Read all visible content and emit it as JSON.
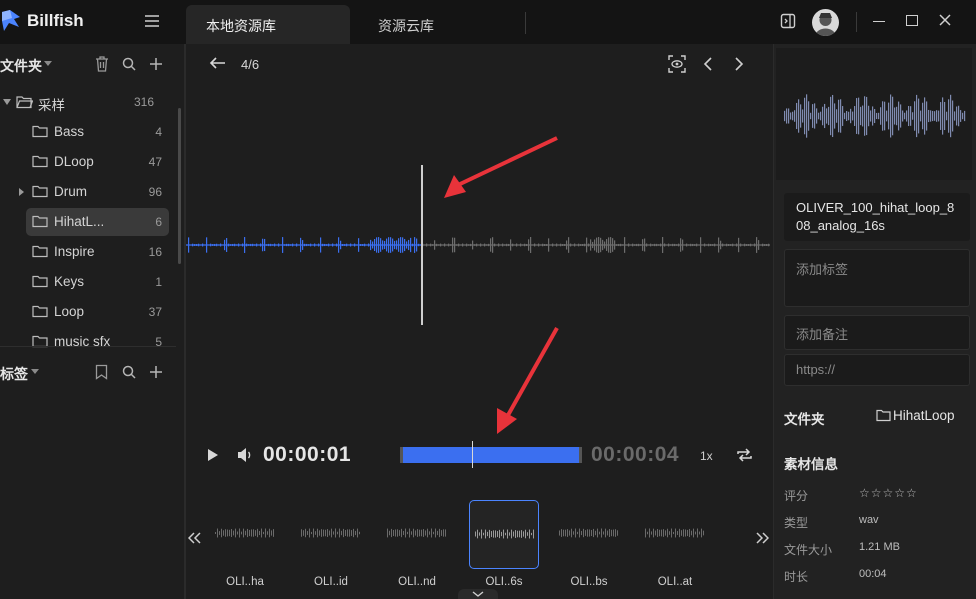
{
  "app": {
    "name": "Billfish"
  },
  "tabs": [
    {
      "label": "本地资源库",
      "active": true
    },
    {
      "label": "资源云库",
      "active": false
    }
  ],
  "sidebar": {
    "folders_title": "文件夹",
    "tags_title": "标签",
    "root": {
      "label": "采样",
      "count": "316"
    },
    "items": [
      {
        "label": "Bass",
        "count": "4"
      },
      {
        "label": "DLoop",
        "count": "47"
      },
      {
        "label": "Drum",
        "count": "96"
      },
      {
        "label": "HihatL...",
        "count": "6",
        "active": true
      },
      {
        "label": "Inspire",
        "count": "16"
      },
      {
        "label": "Keys",
        "count": "1"
      },
      {
        "label": "Loop",
        "count": "37"
      },
      {
        "label": "music sfx",
        "count": "5"
      }
    ]
  },
  "viewer": {
    "counter": "4/6",
    "played_fraction": 0.41
  },
  "player": {
    "current_time": "00:00:01",
    "total_time": "00:00:04",
    "speed": "1x",
    "progress_fraction": 0.41
  },
  "thumbnails": [
    {
      "label": "OLI..ha"
    },
    {
      "label": "OLI..id"
    },
    {
      "label": "OLI..nd"
    },
    {
      "label": "OLI..6s",
      "selected": true
    },
    {
      "label": "OLI..bs"
    },
    {
      "label": "OLI..at"
    }
  ],
  "details": {
    "file_name": "OLIVER_100_hihat_loop_808_analog_16s",
    "tags_placeholder": "添加标签",
    "note_placeholder": "添加备注",
    "url_placeholder": "https://",
    "folder_key": "文件夹",
    "folder_value": "HihatLoop",
    "info_title": "素材信息",
    "info": [
      {
        "key": "评分",
        "value": "☆☆☆☆☆"
      },
      {
        "key": "类型",
        "value": "wav"
      },
      {
        "key": "文件大小",
        "value": "1.21 MB"
      },
      {
        "key": "时长",
        "value": "00:04"
      }
    ]
  },
  "colors": {
    "accent": "#4b84ff",
    "wave_played": "#3b6ff0",
    "wave_unplayed": "#6d6d6d",
    "annotation_arrow": "#e8333a"
  }
}
